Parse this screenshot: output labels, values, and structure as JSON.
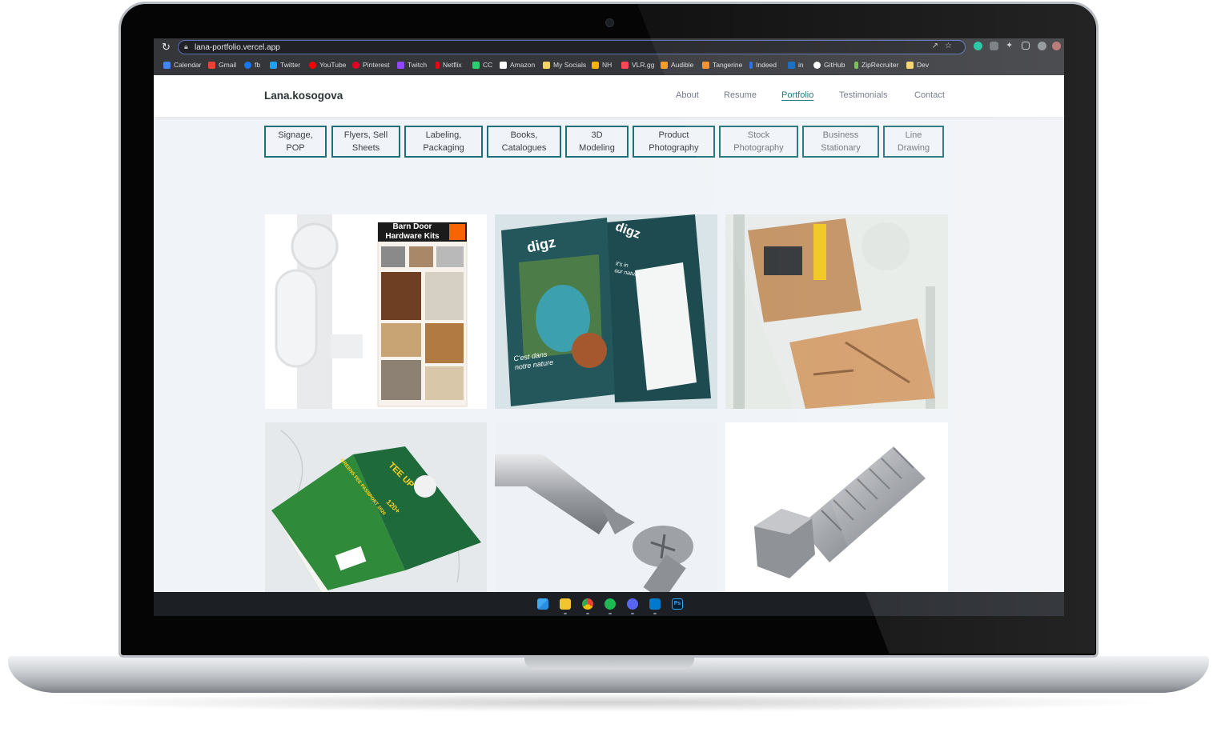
{
  "browser": {
    "url": "lana-portfolio.vercel.app",
    "bookmarks": [
      {
        "label": "Calendar",
        "icon": "calendar-icon",
        "color": "#4285f4"
      },
      {
        "label": "Gmail",
        "icon": "gmail-icon",
        "color": "#ea4335"
      },
      {
        "label": "fb",
        "icon": "facebook-icon",
        "color": "#1877f2"
      },
      {
        "label": "Twitter",
        "icon": "twitter-icon",
        "color": "#1da1f2"
      },
      {
        "label": "YouTube",
        "icon": "youtube-icon",
        "color": "#ff0000"
      },
      {
        "label": "Pinterest",
        "icon": "pinterest-icon",
        "color": "#e60023"
      },
      {
        "label": "Twitch",
        "icon": "twitch-icon",
        "color": "#9146ff"
      },
      {
        "label": "Netflix",
        "icon": "netflix-icon",
        "color": "#e50914"
      },
      {
        "label": "CC",
        "icon": "cc-icon",
        "color": "#2ecc71"
      },
      {
        "label": "Amazon",
        "icon": "amazon-icon",
        "color": "#ffffff"
      },
      {
        "label": "My Socials",
        "icon": "folder-icon",
        "color": "#f6d365"
      },
      {
        "label": "NH",
        "icon": "nh-icon",
        "color": "#f4b400"
      },
      {
        "label": "VLR.gg",
        "icon": "vlr-icon",
        "color": "#ff4655"
      },
      {
        "label": "Audible",
        "icon": "audible-icon",
        "color": "#f8991c"
      },
      {
        "label": "Tangerine",
        "icon": "tangerine-icon",
        "color": "#f28c28"
      },
      {
        "label": "Indeed",
        "icon": "indeed-icon",
        "color": "#2164f3"
      },
      {
        "label": "in",
        "icon": "linkedin-icon",
        "color": "#0a66c2"
      },
      {
        "label": "GitHub",
        "icon": "github-icon",
        "color": "#ffffff"
      },
      {
        "label": "ZipRecruiter",
        "icon": "ziprecruiter-icon",
        "color": "#6ebd45"
      },
      {
        "label": "Dev",
        "icon": "folder-icon",
        "color": "#f6d365"
      }
    ]
  },
  "site": {
    "brand": "Lana.kosogova",
    "nav": [
      {
        "label": "About",
        "active": false
      },
      {
        "label": "Resume",
        "active": false
      },
      {
        "label": "Portfolio",
        "active": true
      },
      {
        "label": "Testimonials",
        "active": false
      },
      {
        "label": "Contact",
        "active": false
      }
    ],
    "filters": [
      {
        "line1": "Signage,",
        "line2": "POP"
      },
      {
        "line1": "Flyers, Sell",
        "line2": "Sheets"
      },
      {
        "line1": "Labeling,",
        "line2": "Packaging"
      },
      {
        "line1": "Books,",
        "line2": "Catalogues"
      },
      {
        "line1": "3D",
        "line2": "Modeling"
      },
      {
        "line1": "Product",
        "line2": "Photography"
      },
      {
        "line1": "Stock",
        "line2": "Photography"
      },
      {
        "line1": "Business",
        "line2": "Stationary"
      },
      {
        "line1": "Line",
        "line2": "Drawing"
      }
    ],
    "tiles": {
      "barn_door_title_1": "Barn Door",
      "barn_door_title_2": "Hardware Kits",
      "flyer_brand": "digz",
      "flyer_tag_1": "C'est dans",
      "flyer_tag_2": "notre nature",
      "flyer_back_tag_1": "it's in",
      "flyer_back_tag_2": "our nature",
      "book_title": "TEE UP",
      "book_spine": "GREENS FEE PASSPORT 2020",
      "book_stats": "120+"
    }
  },
  "taskbar": {
    "apps": [
      "windows-start-icon",
      "file-explorer-icon",
      "chrome-icon",
      "spotify-icon",
      "discord-icon",
      "vscode-icon",
      "photoshop-icon"
    ]
  }
}
